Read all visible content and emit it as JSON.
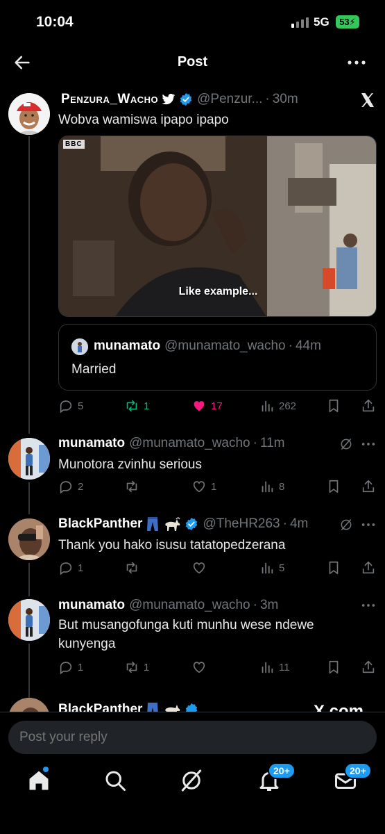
{
  "status_bar": {
    "time": "10:04",
    "network": "5G",
    "battery": "53"
  },
  "header": {
    "title": "Post"
  },
  "main_post": {
    "author_name": "Penzura_Wacho",
    "author_handle": "@Penzur...",
    "time": "30m",
    "text": "Wobva wamiswa ipapo ipapo",
    "media_badge": "BBC",
    "media_caption": "Like example...",
    "quoted": {
      "name": "munamato",
      "handle": "@munamato_wacho",
      "time": "44m",
      "text": "Married"
    },
    "stats": {
      "replies": "5",
      "reposts": "1",
      "likes": "17",
      "views": "262"
    }
  },
  "replies": [
    {
      "name": "munamato",
      "handle": "@munamato_wacho",
      "time": "11m",
      "text": "Munotora zvinhu serious",
      "stats": {
        "replies": "2",
        "reposts": "",
        "likes": "1",
        "views": "8"
      }
    },
    {
      "name": "BlackPanther",
      "handle": "@TheHR263",
      "time": "4m",
      "text": "Thank you hako isusu tatatopedzerana",
      "stats": {
        "replies": "1",
        "reposts": "",
        "likes": "",
        "views": "5"
      }
    },
    {
      "name": "munamato",
      "handle": "@munamato_wacho",
      "time": "3m",
      "text": "But musangofunga kuti munhu wese ndewe kunyenga",
      "stats": {
        "replies": "1",
        "reposts": "1",
        "likes": "",
        "views": "11"
      }
    },
    {
      "name": "BlackPanther"
    }
  ],
  "watermark": "X.com",
  "reply_box": {
    "placeholder": "Post your reply"
  },
  "nav": {
    "notifications_badge": "20+",
    "messages_badge": "20+"
  },
  "colors": {
    "accent": "#1d9bf0",
    "like": "#f91880",
    "repost": "#00ba7c",
    "muted": "#71767b"
  }
}
